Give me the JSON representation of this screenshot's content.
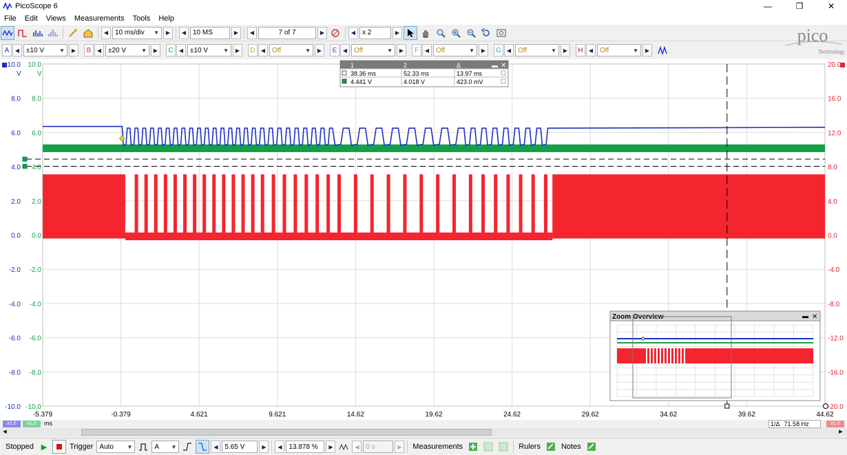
{
  "window": {
    "title": "PicoScope 6",
    "controls": [
      "—",
      "❐",
      "✕"
    ]
  },
  "menu": [
    "File",
    "Edit",
    "Views",
    "Measurements",
    "Tools",
    "Help"
  ],
  "toolbar": {
    "timebase": "10 ms/div",
    "samples": "10 MS",
    "buffer": "7 of 7",
    "zoom": "x 2"
  },
  "channels": [
    {
      "letter": "A",
      "range": "±10 V",
      "color": "#1e2fc4"
    },
    {
      "letter": "B",
      "range": "±20 V",
      "color": "#e0262f"
    },
    {
      "letter": "C",
      "range": "±10 V",
      "color": "#16a04a"
    },
    {
      "letter": "D",
      "range": "Off",
      "color": "#c9a227"
    },
    {
      "letter": "E",
      "range": "Off",
      "color": "#7a2fb0"
    },
    {
      "letter": "F",
      "range": "Off",
      "color": "#999999"
    },
    {
      "letter": "G",
      "range": "Off",
      "color": "#2aa7b8"
    },
    {
      "letter": "H",
      "range": "Off",
      "color": "#8b1d2b"
    }
  ],
  "logo": {
    "text": "pico",
    "sub": "Technology"
  },
  "left_axis": {
    "unit_a": "V",
    "unit_c": "V",
    "ticks": [
      "10.0",
      "8.0",
      "6.0",
      "4.0",
      "2.0",
      "0.0",
      "-2.0",
      "-4.0",
      "-6.0",
      "-8.0",
      "-10.0"
    ]
  },
  "left_axis2": {
    "ticks": [
      "10.0",
      "8.0",
      "6.0",
      "4.0",
      "2.0",
      "0.0",
      "-2.0",
      "-4.0",
      "-6.0",
      "-8.0",
      "-10.0"
    ]
  },
  "right_axis": {
    "ticks": [
      "20.0",
      "16.0",
      "12.0",
      "8.0",
      "4.0",
      "0.0",
      "-4.0",
      "-8.0",
      "-12.0",
      "-16.0",
      "-20.0"
    ]
  },
  "x_axis": {
    "ticks": [
      "-5.379",
      "-0.379",
      "4.621",
      "9.621",
      "14.62",
      "19.62",
      "24.62",
      "29.62",
      "34.62",
      "39.62",
      "44.62"
    ],
    "unit": "ms"
  },
  "rulers_table": {
    "headers": [
      "1",
      "2",
      "Δ"
    ],
    "rows": [
      [
        "38.36 ms",
        "52.33 ms",
        "13.97 ms"
      ],
      [
        "4.441 V",
        "4.018 V",
        "423.0 mV"
      ]
    ]
  },
  "zoom_overview": {
    "title": "Zoom Overview"
  },
  "axis_badges": {
    "a": "x1.0",
    "c": "x1.0",
    "right": "x1.0"
  },
  "frequency": "71.58 Hz",
  "frequency_label": "1/Δ",
  "status": {
    "state": "Stopped",
    "trigger_label": "Trigger",
    "trigger_mode": "Auto",
    "trigger_channel": "A",
    "threshold": "5.65 V",
    "pretrigger": "13.878 %",
    "delay": "0 s",
    "measurements": "Measurements",
    "rulers": "Rulers",
    "notes": "Notes"
  }
}
